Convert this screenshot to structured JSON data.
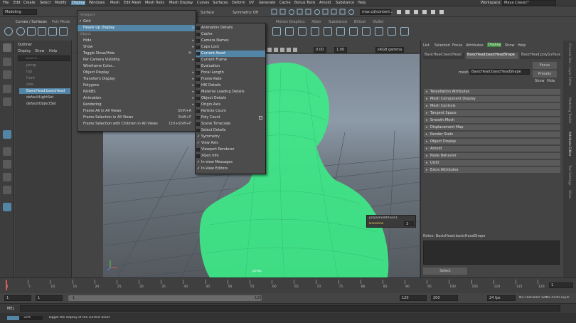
{
  "menubar": {
    "items": [
      "File",
      "Edit",
      "Create",
      "Select",
      "Modify",
      "Display",
      "Windows",
      "Mesh",
      "Edit Mesh",
      "Mesh Tools",
      "Mesh Display",
      "Curves",
      "Surfaces",
      "Deform",
      "UV",
      "Generate",
      "Cache",
      "Bonus Tools",
      "Arnold",
      "Substance",
      "Help"
    ],
    "workspace_label": "Workspace:",
    "workspace_value": "Maya Classic*"
  },
  "statusline": {
    "mode": "Modeling",
    "surface_label": "Surface",
    "symmetry": "Symmetry: Off",
    "scene_field": "max.cd/content..."
  },
  "shelf": {
    "tabs": [
      "Curves / Surfaces",
      "Poly Mode"
    ],
    "right_tabs": [
      "Motion Graphics",
      "XGen",
      "Substance",
      "Bifrost",
      "Bullet"
    ]
  },
  "outliner": {
    "title": "Outliner",
    "menu": [
      "Display",
      "Show",
      "Help"
    ],
    "search_placeholder": "Search...",
    "items": [
      "persp",
      "top",
      "front",
      "side",
      "BasicHead:basicHead",
      "defaultLightSet",
      "defaultObjectSet"
    ]
  },
  "viewport": {
    "toolbar_value1": "0.00",
    "toolbar_value2": "1.00",
    "colorspace": "sRGB gamma",
    "camera_label": "persp",
    "hud_title": "polySmoothFace1",
    "hud_label": "Divisions",
    "hud_value": "3"
  },
  "display_menu": {
    "items": [
      {
        "label": "Viewport",
        "type": "section"
      },
      {
        "label": "Grid",
        "check": true
      },
      {
        "label": "Heads Up Display",
        "submenu": true,
        "highlight": true
      },
      {
        "label": "Object",
        "type": "section"
      },
      {
        "label": "Hide",
        "submenu": true
      },
      {
        "label": "Show",
        "submenu": true
      },
      {
        "label": "Toggle Show/Hide",
        "shortcut": "H"
      },
      {
        "label": "Per Camera Visibility",
        "submenu": true
      },
      {
        "label": "Wireframe Color..."
      },
      {
        "label": "Object Display",
        "submenu": true
      },
      {
        "label": "Transform Display",
        "submenu": true
      },
      {
        "label": "Polygons",
        "submenu": true
      },
      {
        "label": "NURBS",
        "submenu": true
      },
      {
        "label": "Animation",
        "submenu": true
      },
      {
        "label": "Rendering",
        "submenu": true
      },
      {
        "label": "Frame All in All Views",
        "shortcut": "Shift+A"
      },
      {
        "label": "Frame Selection in All Views",
        "shortcut": "Shift+F"
      },
      {
        "label": "Frame Selection with Children in All Views",
        "shortcut": "Ctrl+Shift+F"
      }
    ]
  },
  "hud_menu": {
    "items": [
      {
        "label": "Animation Details"
      },
      {
        "label": "Cache"
      },
      {
        "label": "Camera Names"
      },
      {
        "label": "Caps Lock"
      },
      {
        "label": "Current Asset",
        "highlight": true
      },
      {
        "label": "Current Frame"
      },
      {
        "label": "Evaluation"
      },
      {
        "label": "Focal Length"
      },
      {
        "label": "Frame Rate"
      },
      {
        "label": "HIK Details"
      },
      {
        "label": "Material Loading Details"
      },
      {
        "label": "Object Details"
      },
      {
        "label": "Origin Axis"
      },
      {
        "label": "Particle Count"
      },
      {
        "label": "Poly Count",
        "box": true
      },
      {
        "label": "Scene Timecode"
      },
      {
        "label": "Select Details"
      },
      {
        "label": "Symmetry",
        "check": true
      },
      {
        "label": "View Axis",
        "check": true
      },
      {
        "label": "Viewport Renderer"
      },
      {
        "label": "XGen Info"
      },
      {
        "label": "In-view Messages",
        "check": true
      },
      {
        "label": "In-View Editors",
        "check": true
      }
    ]
  },
  "attribute_editor": {
    "menu": [
      "List",
      "Selected",
      "Focus",
      "Attributes",
      "Display",
      "Show",
      "Help"
    ],
    "tabs": [
      "BasicHead:basicHead",
      "BasicHead:basicHeadShape",
      "BasicHead:polySurface"
    ],
    "mesh_label": "mesh:",
    "mesh_value": "BasicHead:basicHeadShape",
    "focus_btn": "Focus",
    "presets_btn": "Presets",
    "show_btn": "Show",
    "hide_btn": "Hide",
    "sections": [
      "Tessellation Attributes",
      "Mesh Component Display",
      "Mesh Controls",
      "Tangent Space",
      "Smooth Mesh",
      "Displacement Map",
      "Render Stats",
      "Object Display",
      "Arnold",
      "Node Behavior",
      "UUID",
      "Extra Attributes"
    ],
    "notes_label": "Notes: BasicHead:basicHeadShape",
    "select_btn": "Select"
  },
  "right_strip": [
    "Channel Box / Layer Editor",
    "Modeling Toolkit",
    "Attribute Editor",
    "Tool Settings",
    "XGen"
  ],
  "timeline": {
    "ticks": [
      "1",
      "5",
      "10",
      "15",
      "20",
      "25",
      "30",
      "35",
      "40",
      "45",
      "50",
      "55",
      "60",
      "65",
      "70",
      "75",
      "80",
      "85",
      "90",
      "95",
      "100",
      "105",
      "110",
      "115",
      "120"
    ],
    "current": "1"
  },
  "range": {
    "start": "1",
    "inner_start": "1",
    "slider_start": "1",
    "slider_end": "120",
    "inner_end": "120",
    "end": "200",
    "fps": "24 fps",
    "character_set": "No Character Set",
    "anim_layer": "No Anim Layer"
  },
  "cmdline": {
    "label": "MEL"
  },
  "helpline": {
    "progress": "33%",
    "text": "Toggle the display of the current asset"
  },
  "colors": {
    "accent": "#5285a6",
    "mesh_green": "#3ee887"
  }
}
